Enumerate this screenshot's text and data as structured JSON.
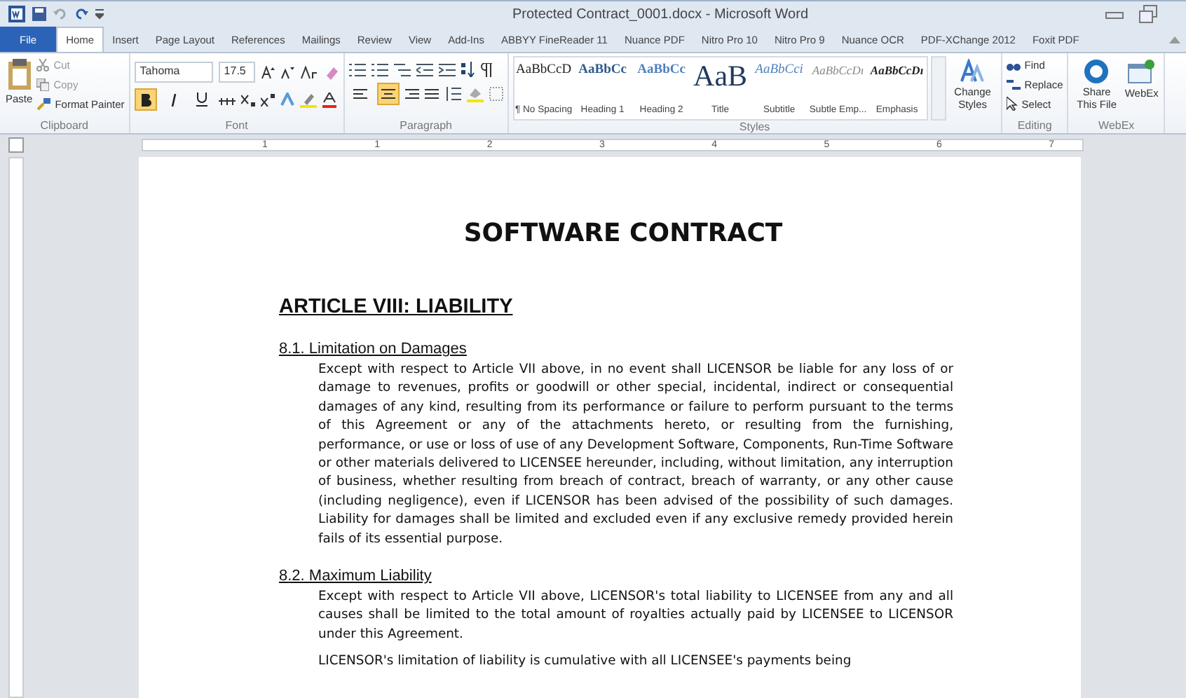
{
  "window": {
    "title": "Protected Contract_0001.docx - Microsoft Word"
  },
  "tabs": [
    {
      "label": "File",
      "kind": "file",
      "selected": false
    },
    {
      "label": "Home",
      "kind": "tab",
      "selected": true
    },
    {
      "label": "Insert",
      "kind": "tab",
      "selected": false
    },
    {
      "label": "Page Layout",
      "kind": "tab",
      "selected": false
    },
    {
      "label": "References",
      "kind": "tab",
      "selected": false
    },
    {
      "label": "Mailings",
      "kind": "tab",
      "selected": false
    },
    {
      "label": "Review",
      "kind": "tab",
      "selected": false
    },
    {
      "label": "View",
      "kind": "tab",
      "selected": false
    },
    {
      "label": "Add-Ins",
      "kind": "tab",
      "selected": false
    },
    {
      "label": "ABBYY FineReader 11",
      "kind": "tab",
      "selected": false
    },
    {
      "label": "Nuance PDF",
      "kind": "tab",
      "selected": false
    },
    {
      "label": "Nitro Pro 10",
      "kind": "tab",
      "selected": false
    },
    {
      "label": "Nitro Pro 9",
      "kind": "tab",
      "selected": false
    },
    {
      "label": "Nuance OCR",
      "kind": "tab",
      "selected": false
    },
    {
      "label": "PDF-XChange 2012",
      "kind": "tab",
      "selected": false
    },
    {
      "label": "Foxit PDF",
      "kind": "tab",
      "selected": false
    }
  ],
  "clipboard": {
    "paste": "Paste",
    "cut": "Cut",
    "copy": "Copy",
    "format_painter": "Format Painter",
    "label": "Clipboard"
  },
  "font": {
    "name": "Tahoma",
    "size": "17.5",
    "label": "Font",
    "bold_on": true,
    "italic_on": false,
    "underline_on": false
  },
  "paragraph": {
    "label": "Paragraph",
    "align_center_on": true,
    "align_left_on": false
  },
  "styles": {
    "label": "Styles",
    "items": [
      {
        "sample": "AaBbCcD",
        "name": "¶ No Spacing",
        "kind": "normal"
      },
      {
        "sample": "AaBbCc",
        "name": "Heading 1",
        "kind": "heading1"
      },
      {
        "sample": "AaBbCc",
        "name": "Heading 2",
        "kind": "heading2"
      },
      {
        "sample": "AaB",
        "name": "Title",
        "kind": "title"
      },
      {
        "sample": "AaBbCci",
        "name": "Subtitle",
        "kind": "subtitle"
      },
      {
        "sample": "AaBbCcDı",
        "name": "Subtle Emp...",
        "kind": "subtle"
      },
      {
        "sample": "AaBbCcDı",
        "name": "Emphasis",
        "kind": "emphasis"
      }
    ],
    "change_styles": "Change Styles"
  },
  "editing": {
    "label": "Editing",
    "find": "Find",
    "replace": "Replace",
    "select": "Select"
  },
  "webex": {
    "label": "WebEx",
    "share": "Share This File",
    "webex": "WebEx"
  },
  "ruler": {
    "ticks": [
      "1",
      "1",
      "2",
      "3",
      "4",
      "5",
      "6",
      "7"
    ]
  },
  "document": {
    "title": "SOFTWARE CONTRACT",
    "article": "ARTICLE VIII: LIABILITY",
    "sections": [
      {
        "heading": "8.1. Limitation on Damages",
        "paragraphs": [
          "Except with respect to Article VII above, in no event shall LICENSOR be liable for any loss of or damage to revenues, profits or goodwill or other special, incidental, indirect or consequential damages of any kind, resulting from its performance or failure to perform pursuant to the terms of this Agreement or any of the attachments hereto, or resulting from the furnishing, performance, or use or loss of use of any Development Software, Components, Run-Time Software or other materials delivered to LICENSEE hereunder, including, without limitation, any interruption of business, whether resulting from breach of contract, breach of warranty, or any other cause (including negligence), even if LICENSOR has been advised of the possibility of such damages. Liability for damages shall be limited and excluded even if any exclusive remedy provided herein fails of its essential purpose."
        ]
      },
      {
        "heading": "8.2. Maximum Liability",
        "paragraphs": [
          "Except with respect to Article VII above, LICENSOR's total liability to LICENSEE from any and all causes shall be limited to the total amount of royalties actually paid by LICENSEE to LICENSOR under this Agreement.",
          "LICENSOR's limitation of liability is cumulative with all LICENSEE's payments being"
        ]
      }
    ]
  }
}
